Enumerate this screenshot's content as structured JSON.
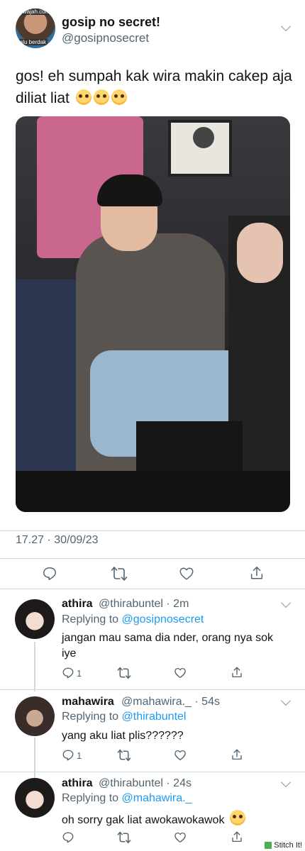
{
  "tweet": {
    "display_name": "gosip no secret!",
    "handle": "@gosipnosecret",
    "avatar_caption_top": "wajah.com",
    "avatar_caption_bottom": "lalu berdak",
    "text": "gos! eh sumpah kak wira makin cakep aja diliat liat",
    "timestamp": "17.27 · 30/09/23"
  },
  "replies": [
    {
      "display_name": "athira",
      "meta": "@thirabuntel · 2m",
      "replying_prefix": "Replying to",
      "replying_to": "@gosipnosecret",
      "text": "jangan mau sama dia nder, orang nya sok iye",
      "reply_count": "1"
    },
    {
      "display_name": "mahawira",
      "meta": "@mahawira._ · 54s",
      "replying_prefix": "Replying to",
      "replying_to": "@thirabuntel",
      "text": "yang aku liat plis??????",
      "reply_count": "1"
    },
    {
      "display_name": "athira",
      "meta": "@thirabuntel · 24s",
      "replying_prefix": "Replying to",
      "replying_to": "@mahawira._",
      "text": "oh sorry gak liat awokawokawok",
      "reply_count": ""
    }
  ],
  "watermark": "Stitch It!",
  "colors": {
    "link": "#1d9bf0",
    "muted": "#536471",
    "divider": "#cfd9de"
  },
  "icons": [
    "reply-icon",
    "retweet-icon",
    "like-icon",
    "share-icon",
    "chevron-down-icon"
  ]
}
